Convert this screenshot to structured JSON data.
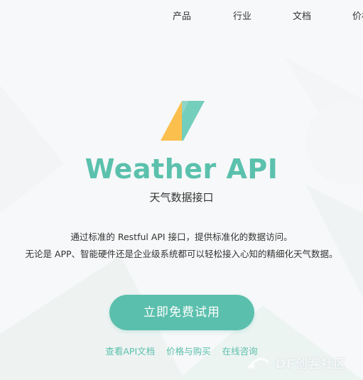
{
  "nav": {
    "items": [
      "产品",
      "行业",
      "文档",
      "价格"
    ]
  },
  "hero": {
    "title": "Weather API",
    "subtitle": "天气数据接口",
    "description_line1": "通过标准的 Restful API 接口，提供标准化的数据访问。",
    "description_line2": "无论是 APP、智能硬件还是企业级系统都可以轻松接入心知的精细化天气数据。",
    "cta_label": "立即免费试用"
  },
  "links": [
    "查看API文档",
    "价格与购买",
    "在线咨询"
  ],
  "watermark": "DF创客社区",
  "colors": {
    "accent": "#5bbfad",
    "logo_orange": "#fbbf4e",
    "logo_green": "#6bcbb7",
    "text": "#333333",
    "background": "#f7f8f9"
  }
}
